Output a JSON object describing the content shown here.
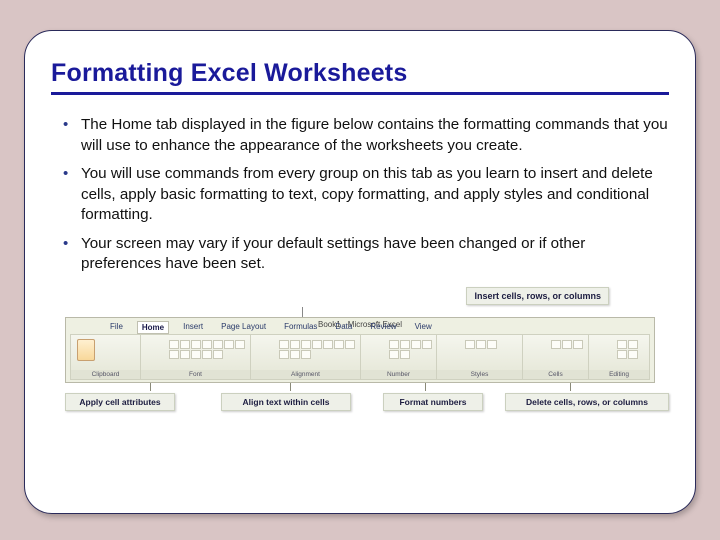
{
  "slide": {
    "title": "Formatting Excel Worksheets",
    "bullets": [
      "The Home tab displayed in the figure below contains the formatting commands that you will use to enhance the appearance of the worksheets you create.",
      "You will use commands from every group on this tab as you learn to insert and delete cells, apply basic formatting to text, copy formatting, and apply styles and conditional formatting.",
      "Your screen may vary if your default settings have been changed or if other preferences have been set."
    ]
  },
  "figure": {
    "callout_top": "Insert cells, rows, or columns",
    "window_title": "Book1 - Microsoft Excel",
    "tabs": [
      "File",
      "Home",
      "Insert",
      "Page Layout",
      "Formulas",
      "Data",
      "Review",
      "View"
    ],
    "group_labels": {
      "clipboard": "Clipboard",
      "font": "Font",
      "alignment": "Alignment",
      "number": "Number",
      "styles": "Styles",
      "cells": "Cells",
      "editing": "Editing"
    },
    "callout_bottom": {
      "a": "Apply cell attributes",
      "b": "Align text within cells",
      "c": "Format numbers",
      "d": "Delete cells, rows, or columns"
    }
  }
}
